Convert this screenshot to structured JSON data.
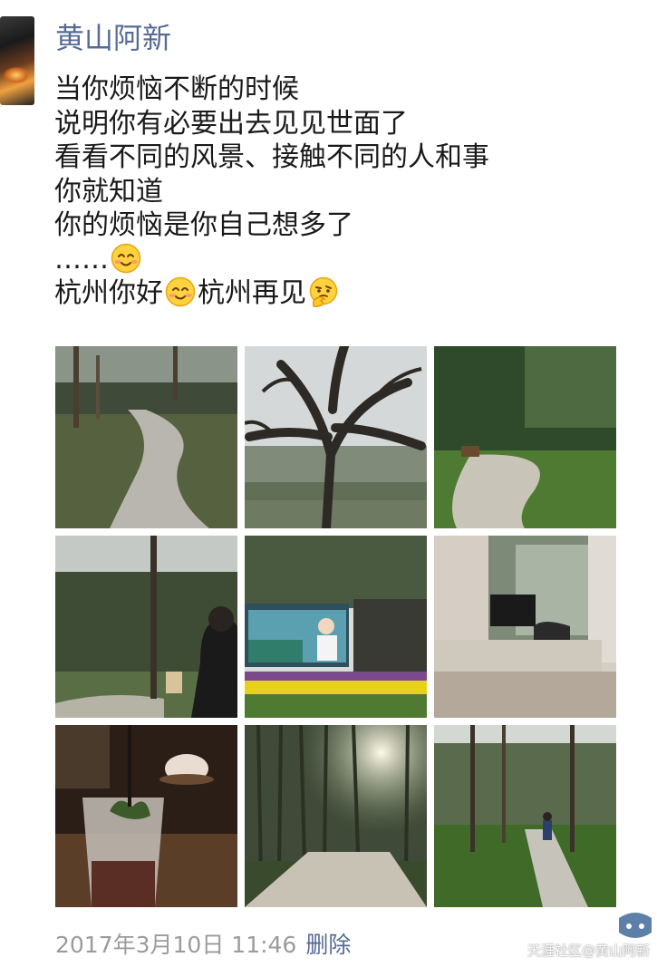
{
  "post": {
    "username": "黄山阿新",
    "lines": [
      "当你烦恼不断的时候",
      "说明你有必要出去见见世面了",
      "看看不同的风景、接触不同的人和事",
      "你就知道",
      "你的烦恼是你自己想多了",
      "……",
      "杭州你好",
      "杭州再见"
    ],
    "emojis": [
      "smile-emoji",
      "smile-emoji",
      "thinking-emoji"
    ],
    "photo_count": 9,
    "timestamp": "2017年3月10日 11:46",
    "delete_label": "删除"
  },
  "watermark": {
    "text": "天涯社区@黄山阿新"
  },
  "colors": {
    "name_link": "#576b95",
    "text": "#1a1a1a",
    "meta": "#9b9b9b"
  }
}
